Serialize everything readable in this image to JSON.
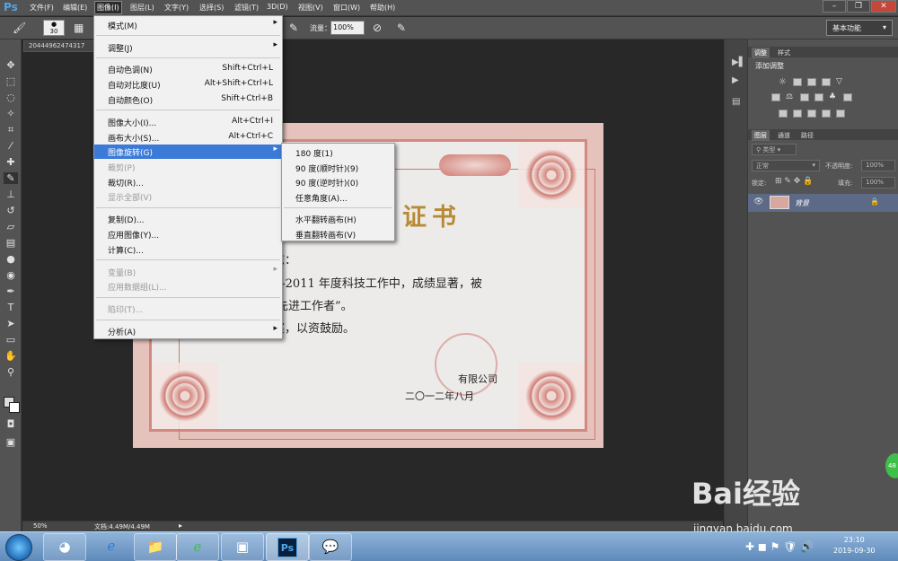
{
  "app": {
    "logo": "Ps"
  },
  "menubar": {
    "items": [
      "文件(F)",
      "编辑(E)",
      "图像(I)",
      "图层(L)",
      "文字(Y)",
      "选择(S)",
      "滤镜(T)",
      "3D(D)",
      "视图(V)",
      "窗口(W)",
      "帮助(H)"
    ],
    "active_index": 2
  },
  "options": {
    "brush_size": "30",
    "flow_label": "流量：",
    "flow_value": "100%",
    "workspace": "基本功能"
  },
  "document": {
    "tab_title": "20444962474317",
    "zoom": "50%",
    "doc_size": "文档:4.49M/4.49M"
  },
  "image_menu": {
    "groups": [
      [
        {
          "label": "模式(M)",
          "submenu": true
        }
      ],
      [
        {
          "label": "调整(J)",
          "submenu": true
        }
      ],
      [
        {
          "label": "自动色调(N)",
          "shortcut": "Shift+Ctrl+L"
        },
        {
          "label": "自动对比度(U)",
          "shortcut": "Alt+Shift+Ctrl+L"
        },
        {
          "label": "自动颜色(O)",
          "shortcut": "Shift+Ctrl+B"
        }
      ],
      [
        {
          "label": "图像大小(I)...",
          "shortcut": "Alt+Ctrl+I"
        },
        {
          "label": "画布大小(S)...",
          "shortcut": "Alt+Ctrl+C"
        },
        {
          "label": "图像旋转(G)",
          "submenu": true,
          "highlighted": true
        },
        {
          "label": "裁剪(P)",
          "disabled": true
        },
        {
          "label": "裁切(R)..."
        },
        {
          "label": "显示全部(V)",
          "disabled": true
        }
      ],
      [
        {
          "label": "复制(D)..."
        },
        {
          "label": "应用图像(Y)..."
        },
        {
          "label": "计算(C)..."
        }
      ],
      [
        {
          "label": "变量(B)",
          "submenu": true,
          "disabled": true
        },
        {
          "label": "应用数据组(L)...",
          "disabled": true
        }
      ],
      [
        {
          "label": "陷印(T)...",
          "disabled": true
        }
      ],
      [
        {
          "label": "分析(A)",
          "submenu": true
        }
      ]
    ]
  },
  "rotate_menu": {
    "groups": [
      [
        "180 度(1)",
        "90 度(顺时针)(9)",
        "90 度(逆时针)(0)",
        "任意角度(A)..."
      ],
      [
        "水平翻转画布(H)",
        "垂直翻转画布(V)"
      ]
    ]
  },
  "certificate": {
    "title": "证书",
    "lines": [
      "志：",
      "9-2011 年度科技工作中，成绩显著，被",
      "先进工作者”。",
      "奖，以资鼓励。"
    ],
    "company": "有限公司",
    "date": "二〇一二年八月"
  },
  "panels": {
    "adjust_tabs": [
      "调整",
      "样式"
    ],
    "adjust_title": "添加调整",
    "layer_tabs": [
      "图层",
      "通道",
      "路径"
    ],
    "kind_select": "类型",
    "blend_mode": "正常",
    "opacity_label": "不透明度:",
    "opacity_value": "100%",
    "lock_label": "锁定:",
    "fill_label": "填充:",
    "fill_value": "100%",
    "layer_name": "背景"
  },
  "taskbar": {
    "time": "23:10",
    "date": "2019-09-30"
  },
  "watermark": {
    "brand": "Bai经验",
    "url": "jingyan.baidu.com",
    "badge": "48"
  },
  "colors": {
    "menu_highlight": "#3b7ad6",
    "ps_blue": "#4ea7e8",
    "layer_selected": "#5c6a88"
  }
}
